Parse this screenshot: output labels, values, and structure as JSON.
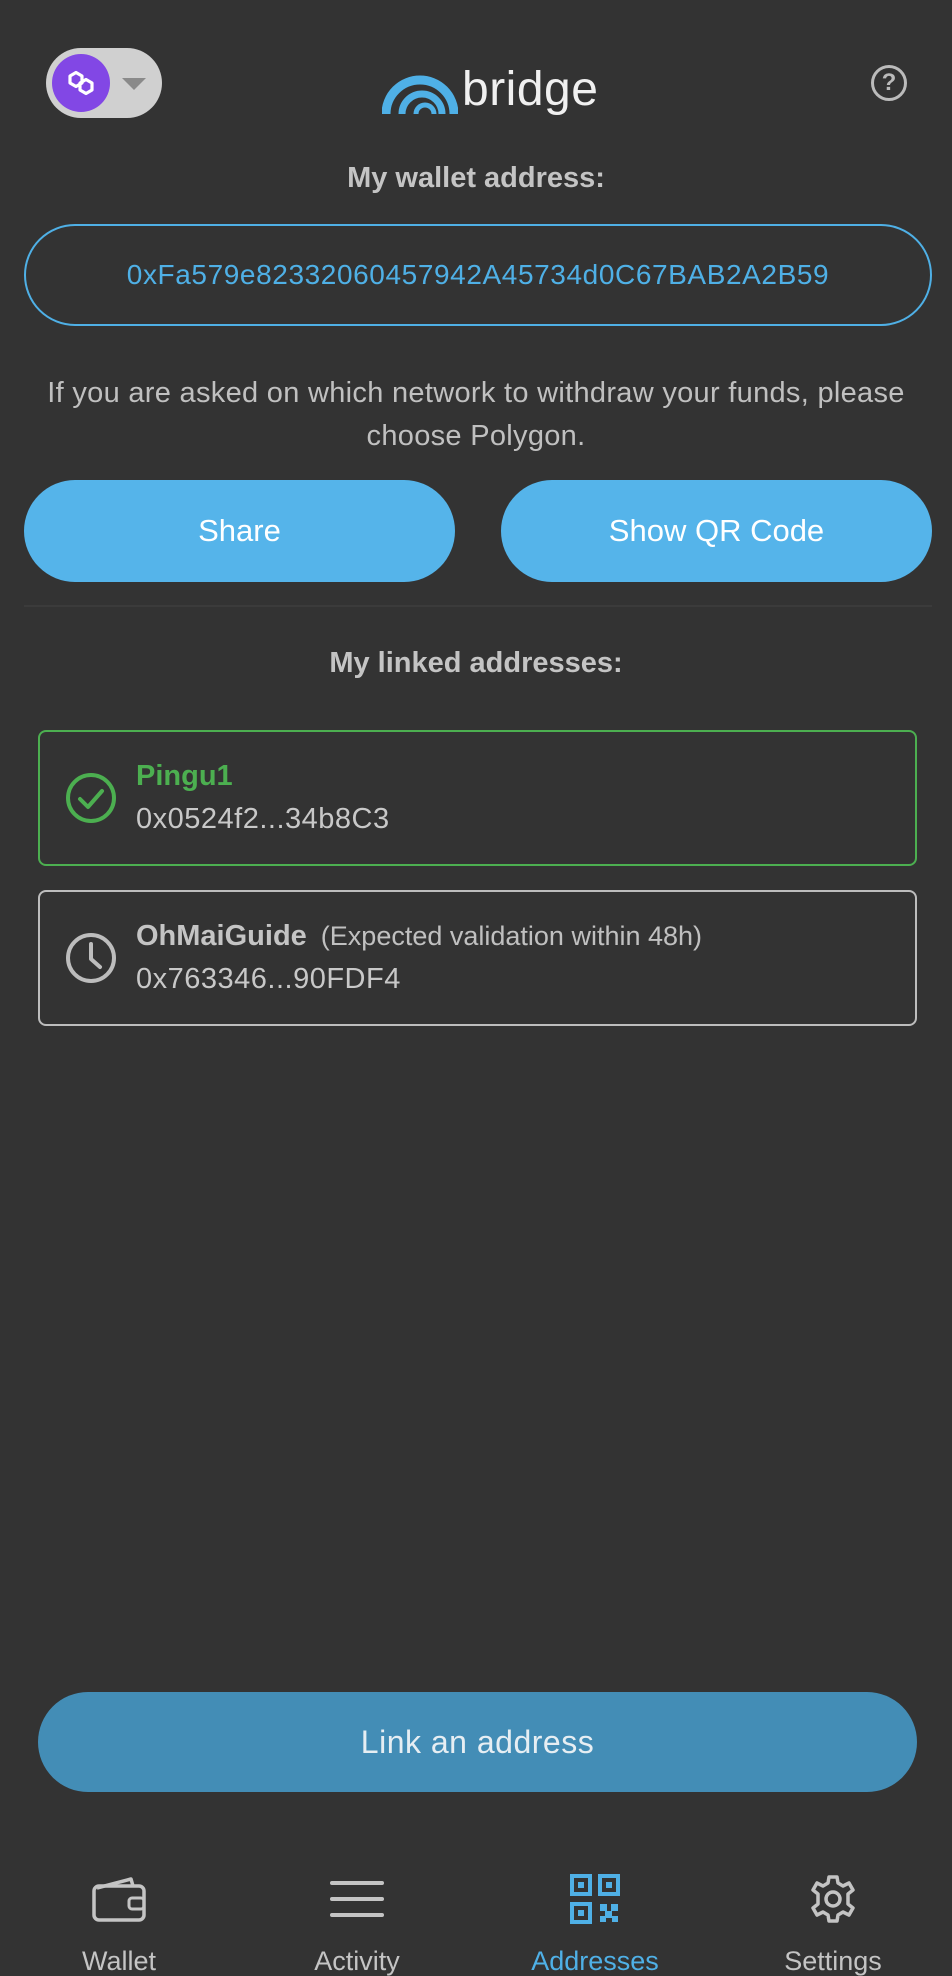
{
  "header": {
    "network_icon": "polygon-icon",
    "logo_text": "bridge",
    "help_icon": "question-circle-icon"
  },
  "wallet": {
    "title": "My wallet address:",
    "address": "0xFa579e82332060457942A45734d0C67BAB2A2B59",
    "notice": "If you are asked on which network to withdraw your funds, please choose Polygon.",
    "share_label": "Share",
    "qr_label": "Show QR Code"
  },
  "linked": {
    "title": "My linked addresses:",
    "items": [
      {
        "name": "Pingu1",
        "note": "",
        "address": "0x0524f2...34b8C3",
        "status": "validated",
        "icon": "check-circle-icon"
      },
      {
        "name": "OhMaiGuide",
        "note": "(Expected validation within 48h)",
        "address": "0x763346...90FDF4",
        "status": "pending",
        "icon": "clock-icon"
      }
    ]
  },
  "link_button": "Link an address",
  "tabs": [
    {
      "label": "Wallet",
      "icon": "wallet-icon",
      "active": false
    },
    {
      "label": "Activity",
      "icon": "list-icon",
      "active": false
    },
    {
      "label": "Addresses",
      "icon": "qr-code-icon",
      "active": true
    },
    {
      "label": "Settings",
      "icon": "gear-icon",
      "active": false
    }
  ],
  "colors": {
    "background": "#333333",
    "accent": "#55b4ea",
    "success": "#4caf50",
    "network": "#8247e5"
  }
}
